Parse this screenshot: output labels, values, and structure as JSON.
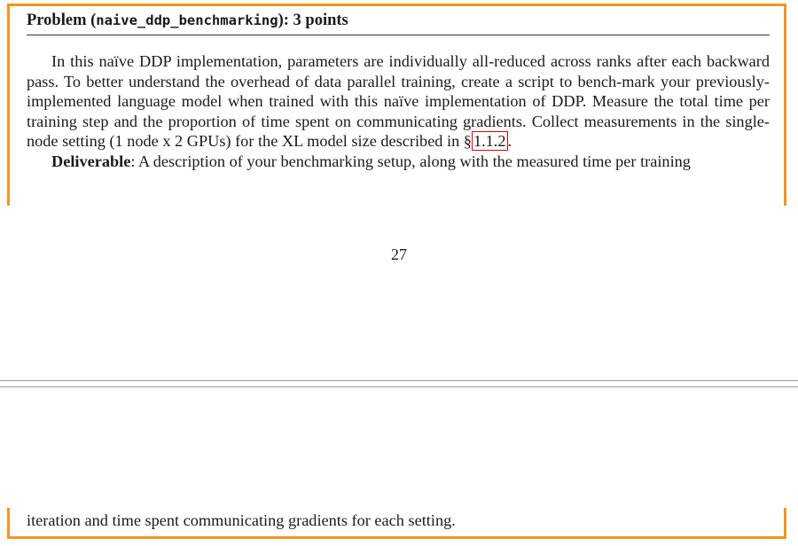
{
  "problem": {
    "title_prefix": "Problem (",
    "title_code": "naive_ddp_benchmarking",
    "title_suffix": "): 3 points",
    "paragraph_1_before_ref": "In this naïve DDP implementation, parameters are individually all-reduced across ranks after each backward pass. To better understand the overhead of data parallel training, create a script to bench-mark your previously-implemented language model when trained with this naïve implementation of DDP. Measure the total time per training step and the proportion of time spent on communicating gradients. Collect measurements in the single-node setting (1 node x 2 GPUs) for the XL model size described in §",
    "section_ref": "1.1.2",
    "paragraph_1_after_ref": ".",
    "deliverable_label": "Deliverable",
    "deliverable_text": ": A description of your benchmarking setup, along with the measured time per training",
    "continuation_text": "iteration and time spent communicating gradients for each setting."
  },
  "page": {
    "number": "27"
  },
  "colors": {
    "box_border": "#f7941d",
    "link_border": "#e00000",
    "separator": "#9a9aa6"
  }
}
